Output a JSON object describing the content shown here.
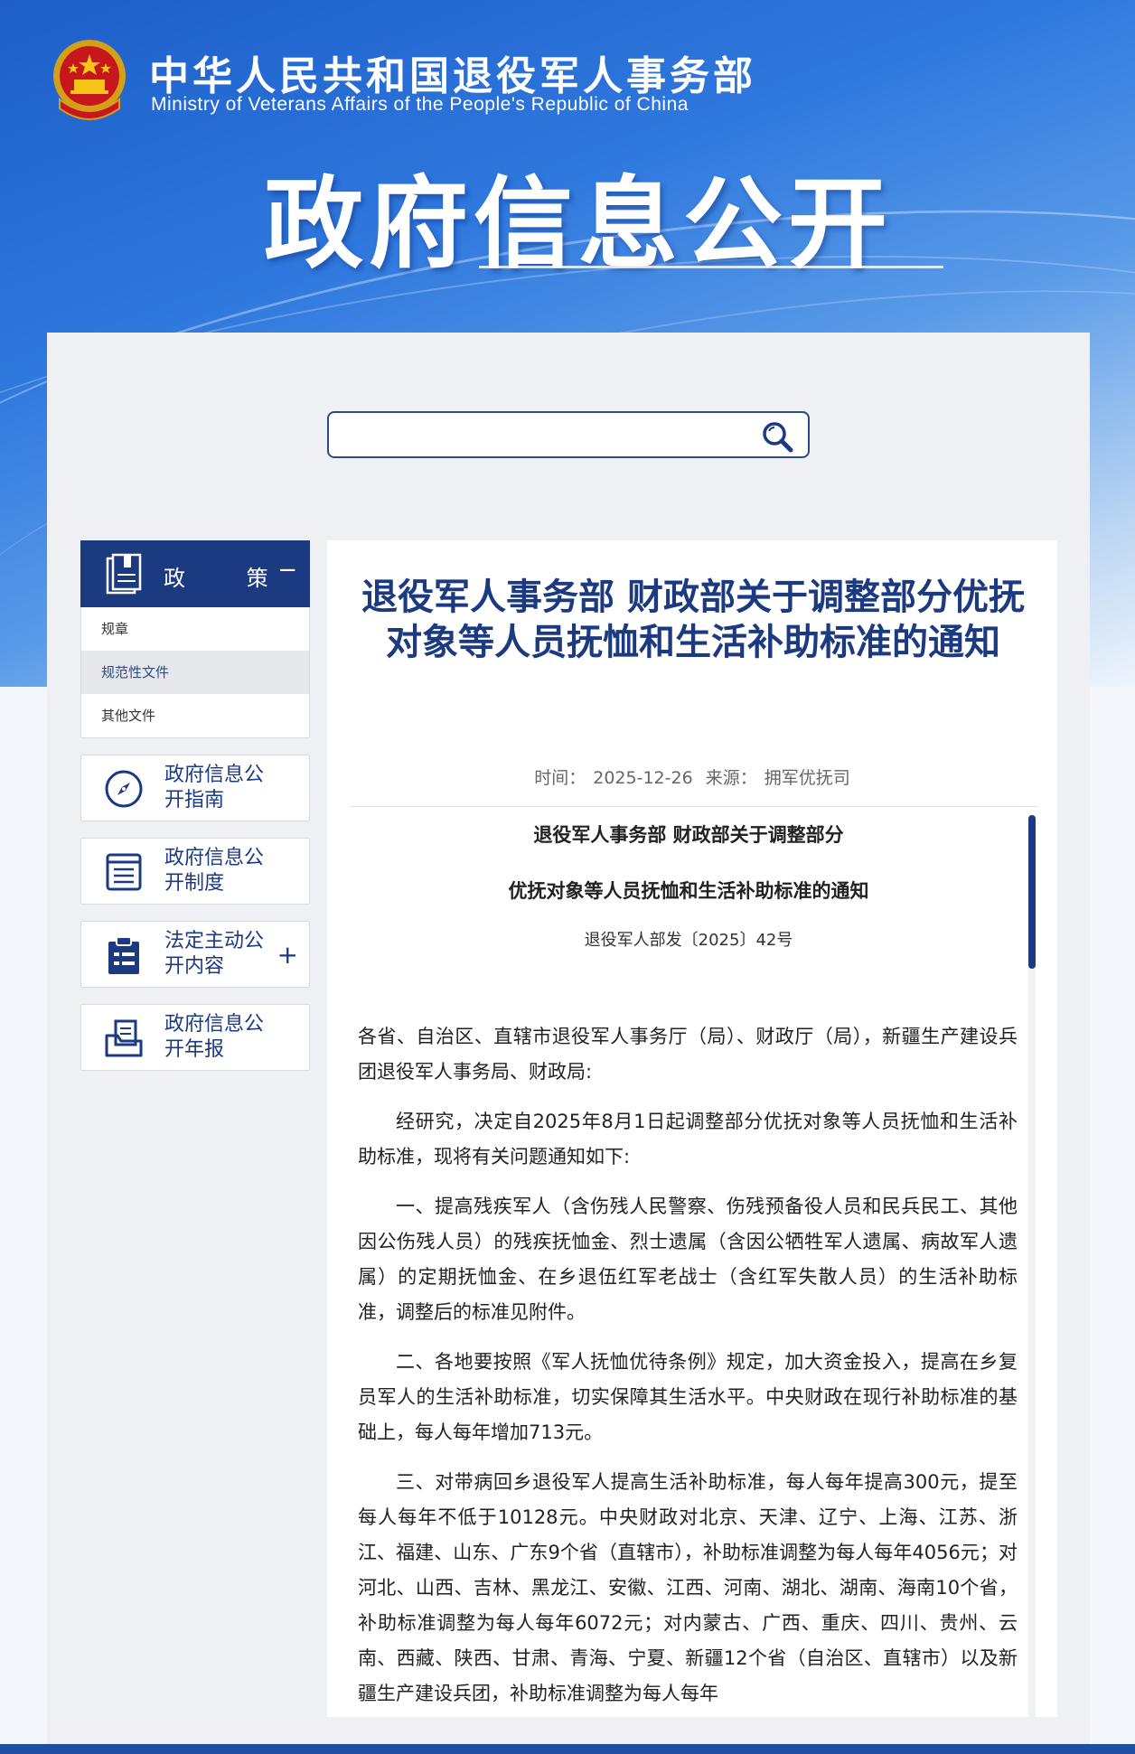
{
  "header": {
    "ministry_cn": "中华人民共和国退役军人事务部",
    "ministry_en": "Ministry of Veterans Affairs of the People's Republic of China",
    "section_title": "政府信息公开"
  },
  "search": {
    "placeholder": ""
  },
  "sidebar": {
    "policy": {
      "label": "政 策",
      "toggle": "−",
      "items": [
        "规章",
        "规范性文件",
        "其他文件"
      ]
    },
    "cards": [
      {
        "label": "政府信息公开指南",
        "icon": "compass-icon"
      },
      {
        "label": "政府信息公开制度",
        "icon": "list-document-icon"
      },
      {
        "label": "法定主动公开内容",
        "icon": "clipboard-icon",
        "toggle": "+"
      },
      {
        "label": "政府信息公开年报",
        "icon": "folder-document-icon"
      }
    ]
  },
  "article": {
    "title": "退役军人事务部 财政部关于调整部分优抚对象等人员抚恤和生活补助标准的通知",
    "meta_time_label": "时间：",
    "meta_time": "2025-12-26",
    "meta_source_label": "来源：",
    "meta_source": "拥军优抚司",
    "doc_title_1": "退役军人事务部 财政部关于调整部分",
    "doc_title_2": "优抚对象等人员抚恤和生活补助标准的通知",
    "doc_number": "退役军人部发〔2025〕42号",
    "paragraphs": [
      "各省、自治区、直辖市退役军人事务厅（局）、财政厅（局），新疆生产建设兵团退役军人事务局、财政局:",
      "经研究，决定自2025年8月1日起调整部分优抚对象等人员抚恤和生活补助标准，现将有关问题通知如下:",
      "一、提高残疾军人（含伤残人民警察、伤残预备役人员和民兵民工、其他因公伤残人员）的残疾抚恤金、烈士遗属（含因公牺牲军人遗属、病故军人遗属）的定期抚恤金、在乡退伍红军老战士（含红军失散人员）的生活补助标准，调整后的标准见附件。",
      "二、各地要按照《军人抚恤优待条例》规定，加大资金投入，提高在乡复员军人的生活补助标准，切实保障其生活水平。中央财政在现行补助标准的基础上，每人每年增加713元。",
      "三、对带病回乡退役军人提高生活补助标准，每人每年提高300元，提至每人每年不低于10128元。中央财政对北京、天津、辽宁、上海、江苏、浙江、福建、山东、广东9个省（直辖市），补助标准调整为每人每年4056元；对河北、山西、吉林、黑龙江、安徽、江西、河南、湖北、湖南、海南10个省，补助标准调整为每人每年6072元；对内蒙古、广西、重庆、四川、贵州、云南、西藏、陕西、甘肃、青海、宁夏、新疆12个省（自治区、直辖市）以及新疆生产建设兵团，补助标准调整为每人每年"
    ]
  },
  "colors": {
    "brand_blue": "#1b3a80",
    "hero_blue": "#2f78de"
  }
}
